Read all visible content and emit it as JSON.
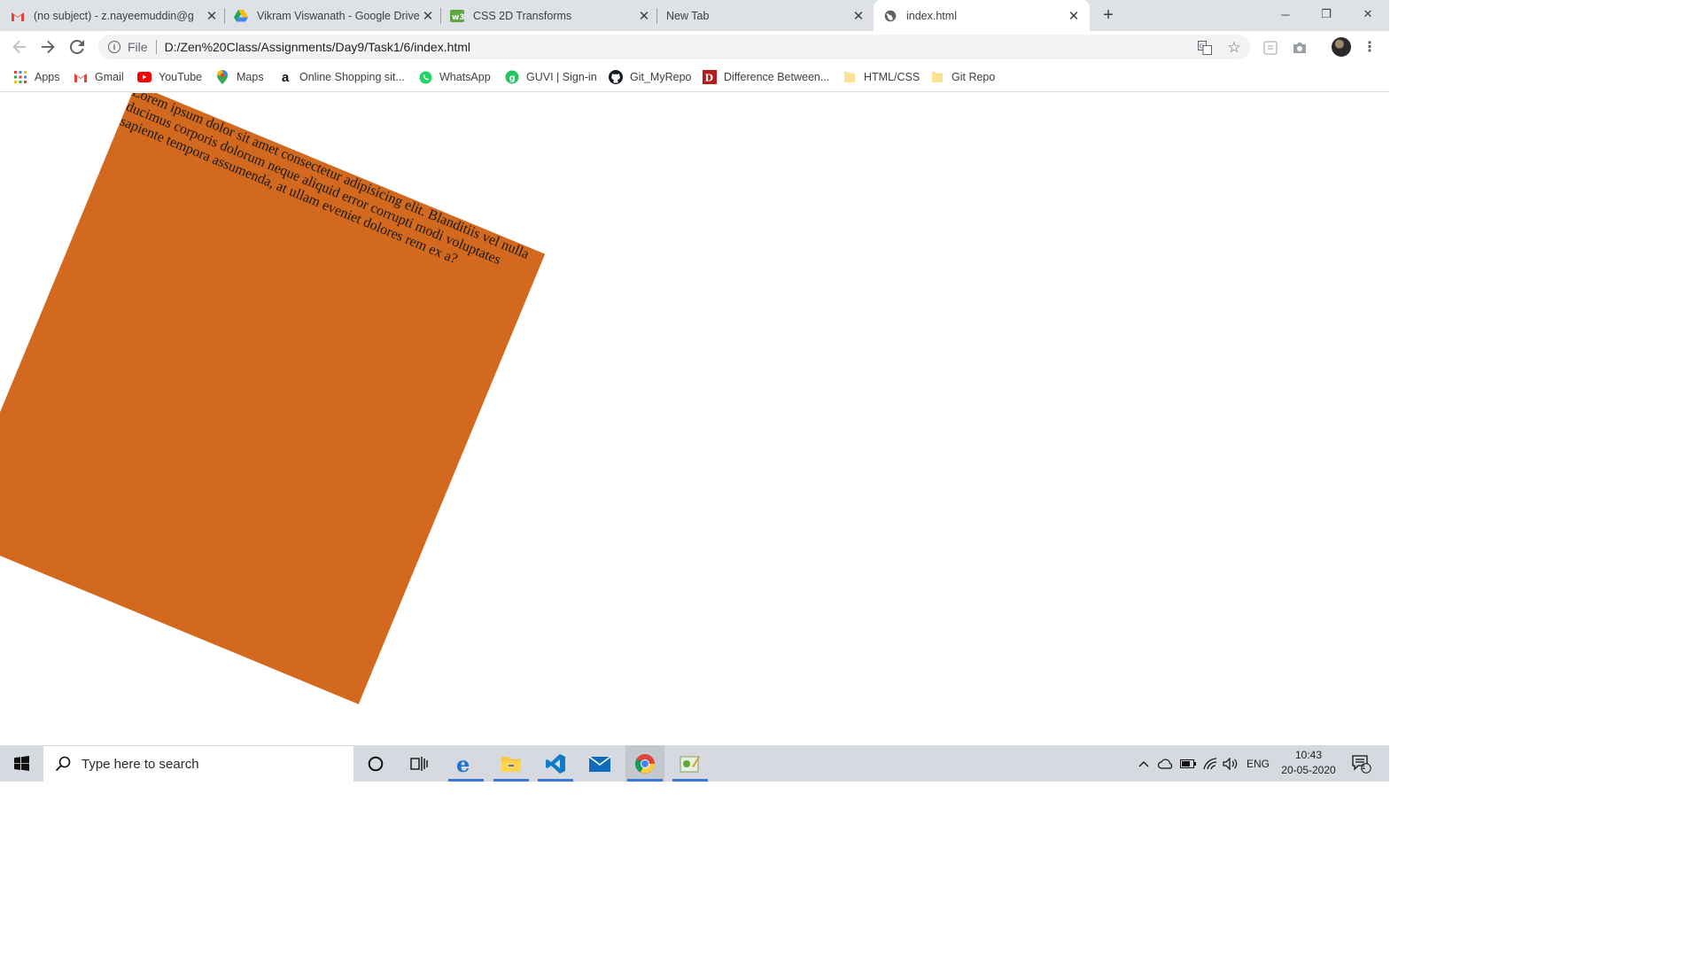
{
  "browser": {
    "tabs": [
      {
        "title": "(no subject) - z.nayeemuddin@g",
        "favicon": "gmail-icon",
        "active": false
      },
      {
        "title": "Vikram Viswanath - Google Drive",
        "favicon": "google-drive-icon",
        "active": false
      },
      {
        "title": "CSS 2D Transforms",
        "favicon": "w3schools-icon",
        "active": false
      },
      {
        "title": "New Tab",
        "favicon": "",
        "active": false
      },
      {
        "title": "index.html",
        "favicon": "globe-icon",
        "active": true
      }
    ],
    "new_tab_symbol": "+",
    "window_controls": {
      "minimize": "─",
      "restore": "❐",
      "close": "✕"
    },
    "omnibox": {
      "scheme_label": "File",
      "url": "D:/Zen%20Class/Assignments/Day9/Task1/6/index.html"
    },
    "bookmarks": [
      {
        "label": "Apps",
        "icon": "apps-grid-icon"
      },
      {
        "label": "Gmail",
        "icon": "gmail-icon"
      },
      {
        "label": "YouTube",
        "icon": "youtube-icon"
      },
      {
        "label": "Maps",
        "icon": "maps-pin-icon"
      },
      {
        "label": "Online Shopping sit...",
        "icon": "amazon-icon"
      },
      {
        "label": "WhatsApp",
        "icon": "whatsapp-icon"
      },
      {
        "label": "GUVI | Sign-in",
        "icon": "guvi-icon"
      },
      {
        "label": "Git_MyRepo",
        "icon": "github-icon"
      },
      {
        "label": "Difference Between...",
        "icon": "difference-icon"
      },
      {
        "label": "HTML/CSS",
        "icon": "folder-icon"
      },
      {
        "label": "Git Repo",
        "icon": "folder-icon"
      }
    ]
  },
  "page": {
    "box_color": "#d2691e",
    "box_rotation_deg": 22.5,
    "paragraph": "Lorem ipsum dolor sit amet consectetur adipisicing elit. Blanditiis vel nulla ducimus corporis dolorum neque aliquid error corrupti modi voluptates sapiente tempora assumenda, at ullam eveniet dolores rem ex a?"
  },
  "taskbar": {
    "search_placeholder": "Type here to search",
    "tray": {
      "language": "ENG",
      "time": "10:43",
      "date": "20-05-2020",
      "notification_count": "1"
    }
  }
}
